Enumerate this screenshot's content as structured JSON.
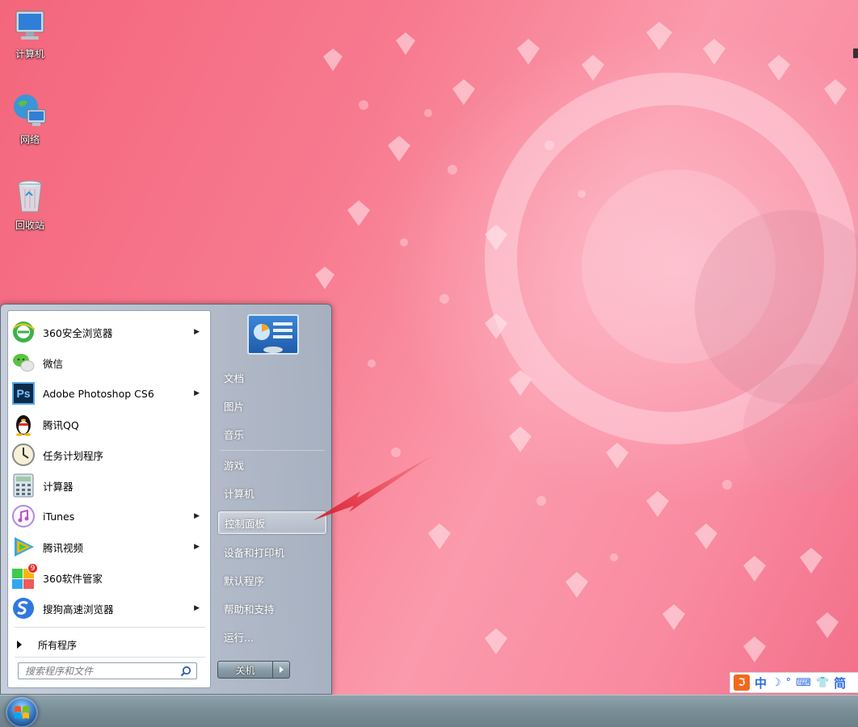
{
  "desktop": {
    "icons": [
      {
        "label": "计算机",
        "icon": "computer-icon"
      },
      {
        "label": "网络",
        "icon": "network-globe-icon"
      },
      {
        "label": "回收站",
        "icon": "recycle-bin-icon"
      }
    ]
  },
  "start_menu": {
    "programs": [
      {
        "label": "360安全浏览器",
        "icon": "360-browser-icon",
        "has_submenu": true
      },
      {
        "label": "微信",
        "icon": "wechat-icon",
        "has_submenu": false
      },
      {
        "label": "Adobe Photoshop CS6",
        "icon": "photoshop-icon",
        "icon_text": "Ps",
        "has_submenu": true
      },
      {
        "label": "腾讯QQ",
        "icon": "qq-penguin-icon",
        "has_submenu": false
      },
      {
        "label": "任务计划程序",
        "icon": "clock-icon",
        "has_submenu": false
      },
      {
        "label": "计算器",
        "icon": "calculator-icon",
        "has_submenu": false
      },
      {
        "label": "iTunes",
        "icon": "itunes-icon",
        "has_submenu": true
      },
      {
        "label": "腾讯视频",
        "icon": "tencent-video-icon",
        "has_submenu": true
      },
      {
        "label": "360软件管家",
        "icon": "360-software-manager-icon",
        "badge": "9",
        "has_submenu": false
      },
      {
        "label": "搜狗高速浏览器",
        "icon": "sogou-browser-icon",
        "has_submenu": true
      }
    ],
    "all_programs_label": "所有程序",
    "search_placeholder": "搜索程序和文件",
    "right_items": [
      {
        "label": "文档",
        "highlighted": false
      },
      {
        "label": "图片",
        "highlighted": false
      },
      {
        "label": "音乐",
        "highlighted": false
      },
      {
        "label": "游戏",
        "highlighted": false
      },
      {
        "label": "计算机",
        "highlighted": false
      },
      {
        "label": "控制面板",
        "highlighted": true
      },
      {
        "label": "设备和打印机",
        "highlighted": false
      },
      {
        "label": "默认程序",
        "highlighted": false
      },
      {
        "label": "帮助和支持",
        "highlighted": false
      },
      {
        "label": "运行...",
        "highlighted": false
      }
    ],
    "shutdown_label": "关机"
  },
  "ime_bar": {
    "logo": "ℑ",
    "mode": "中",
    "script": "简"
  },
  "colors": {
    "annotation_arrow": "#e8343f",
    "highlight_border": "#ffffff"
  }
}
